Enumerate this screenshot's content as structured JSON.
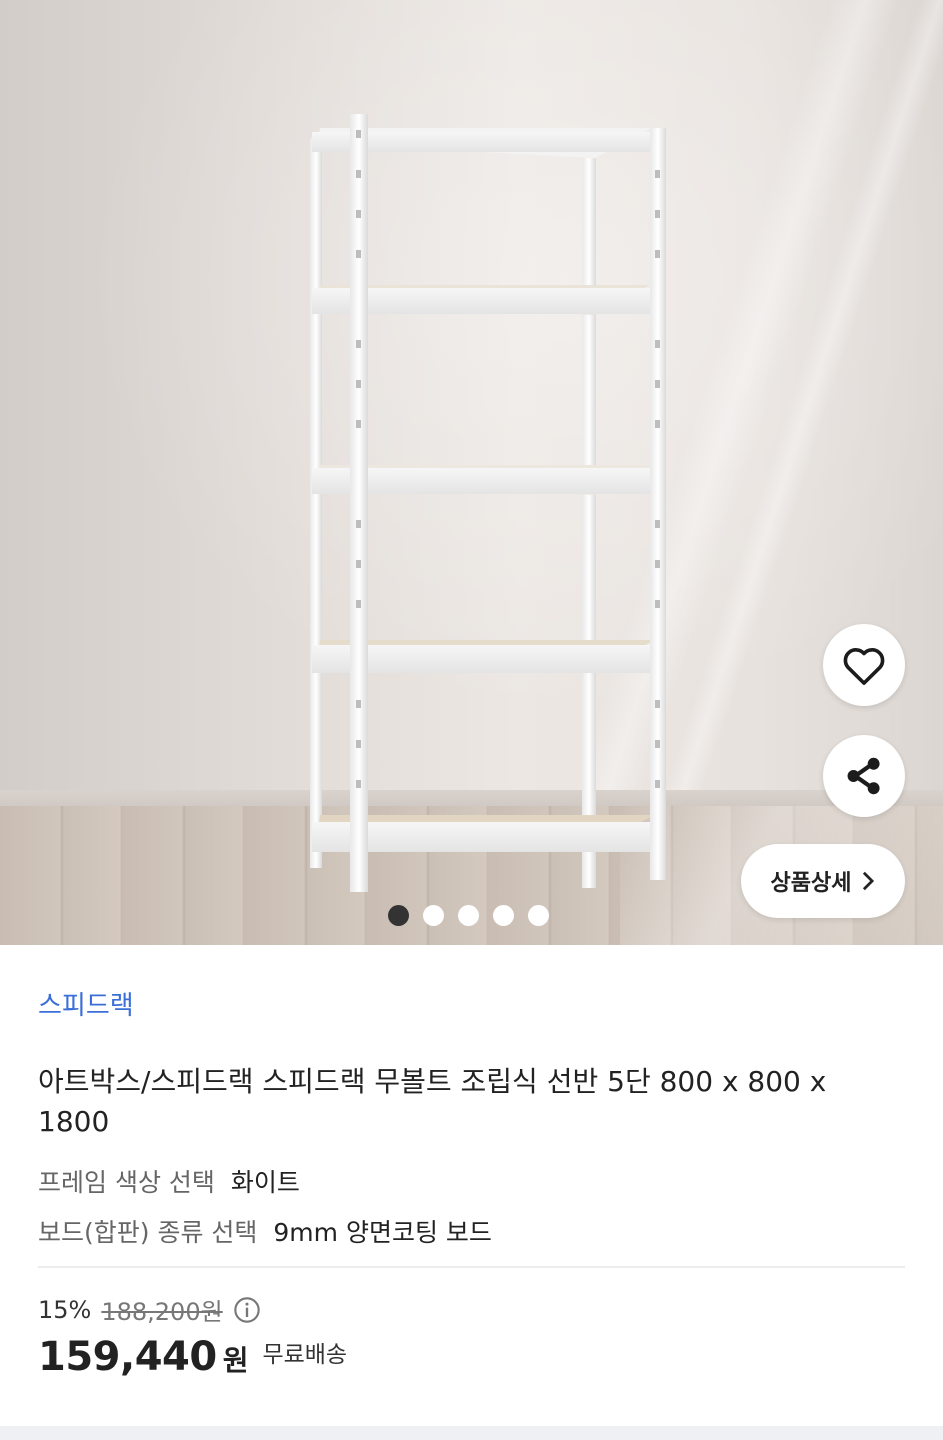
{
  "hero": {
    "image_alt": "화이트 5단 무볼트 조립식 선반",
    "slide_count": 5,
    "active_slide": 1,
    "detail_button_label": "상품상세",
    "icons": {
      "favorite": "heart-icon",
      "share": "share-icon",
      "detail_arrow": "chevron-right-icon"
    }
  },
  "product": {
    "brand": "스피드랙",
    "title": "아트박스/스피드랙 스피드랙 무볼트 조립식 선반 5단 800 x 800 x 1800",
    "options": [
      {
        "label": "프레임 색상 선택",
        "value": "화이트"
      },
      {
        "label": "보드(합판) 종류 선택",
        "value": "9mm 양면코팅 보드"
      }
    ]
  },
  "pricing": {
    "discount": "15%",
    "original_price": "188,200원",
    "price": "159,440",
    "currency": "원",
    "shipping": "무료배송"
  },
  "colors": {
    "brand_link": "#3a6fd8",
    "text": "#222222",
    "secondary_text": "#666666"
  }
}
